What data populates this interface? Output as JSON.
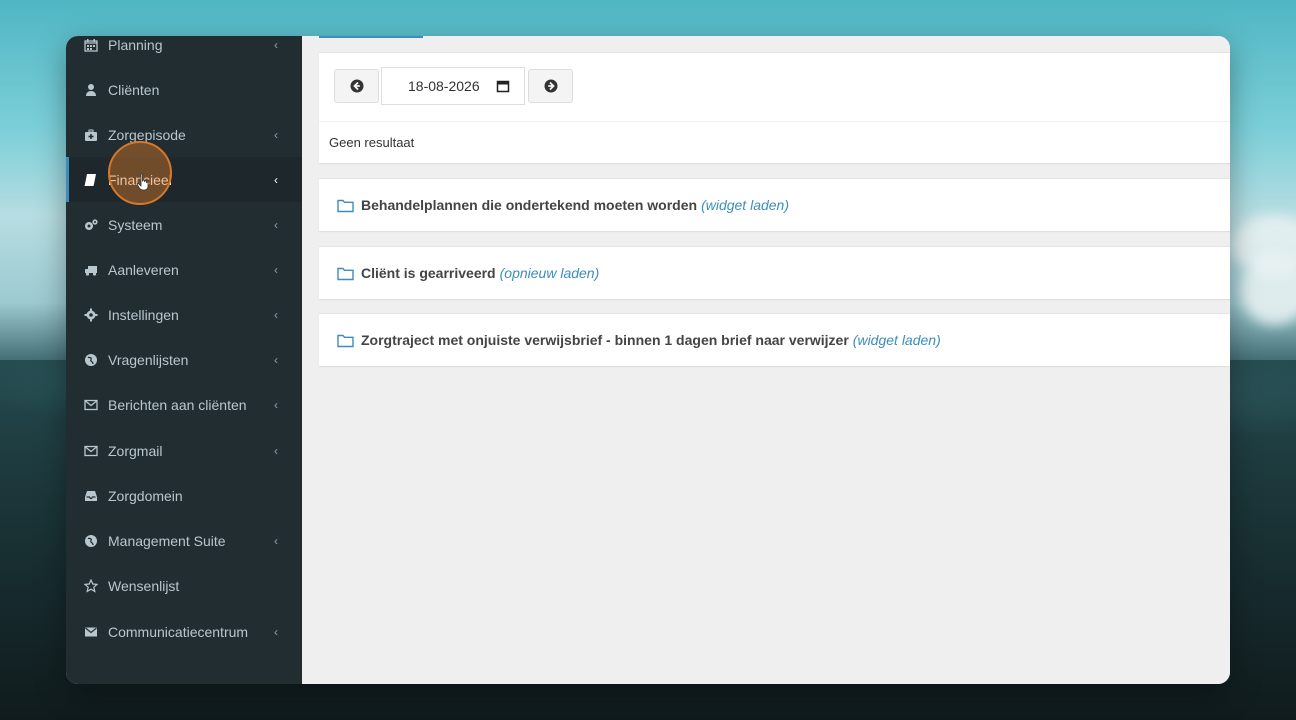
{
  "sidebar": {
    "items": [
      {
        "label": "Planning",
        "icon": "calendar-icon",
        "chevron": true
      },
      {
        "label": "Cliënten",
        "icon": "user-icon",
        "chevron": false
      },
      {
        "label": "Zorgepisode",
        "icon": "medkit-icon",
        "chevron": true
      },
      {
        "label": "Financieel",
        "icon": "book-icon",
        "chevron": true,
        "active": true
      },
      {
        "label": "Systeem",
        "icon": "cogs-icon",
        "chevron": true
      },
      {
        "label": "Aanleveren",
        "icon": "truck-icon",
        "chevron": true
      },
      {
        "label": "Instellingen",
        "icon": "gear-icon",
        "chevron": true
      },
      {
        "label": "Vragenlijsten",
        "icon": "globe-icon",
        "chevron": true
      },
      {
        "label": "Berichten aan cliënten",
        "icon": "envelope-outline-icon",
        "chevron": true
      },
      {
        "label": "Zorgmail",
        "icon": "envelope-outline-icon",
        "chevron": true
      },
      {
        "label": "Zorgdomein",
        "icon": "inbox-icon",
        "chevron": false
      },
      {
        "label": "Management Suite",
        "icon": "globe-icon",
        "chevron": true
      },
      {
        "label": "Wensenlijst",
        "icon": "star-outline-icon",
        "chevron": false
      },
      {
        "label": "Communicatiecentrum",
        "icon": "envelope-icon",
        "chevron": true
      }
    ],
    "chevron_glyph": "‹"
  },
  "date_nav": {
    "date_value": "18-08-2026",
    "prev_icon": "arrow-circle-left-icon",
    "next_icon": "arrow-circle-right-icon",
    "result_text": "Geen resultaat"
  },
  "widgets": [
    {
      "title": "Behandelplannen die ondertekend moeten worden",
      "link": "(widget laden)"
    },
    {
      "title": "Cliënt is gearriveerd",
      "link": "(opnieuw laden)"
    },
    {
      "title": "Zorgtraject met onjuiste verwijsbrief - binnen 1 dagen brief naar verwijzer",
      "link": "(widget laden)"
    }
  ],
  "colors": {
    "sidebar_bg": "#222d32",
    "accent": "#3c8dbc",
    "cursor_highlight": "#d6782a"
  }
}
